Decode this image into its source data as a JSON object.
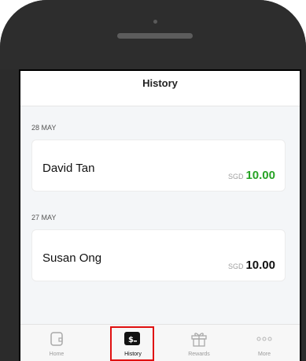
{
  "header": {
    "title": "History"
  },
  "history": [
    {
      "date": "28 MAY",
      "name": "David Tan",
      "currency": "SGD",
      "amount": "10.00",
      "amount_color": "#27a325"
    },
    {
      "date": "27 MAY",
      "name": "Susan Ong",
      "currency": "SGD",
      "amount": "10.00",
      "amount_color": "#111111"
    }
  ],
  "tabs": [
    {
      "label": "Home",
      "icon": "wallet-icon"
    },
    {
      "label": "History",
      "icon": "history-dollar-icon",
      "active": true
    },
    {
      "label": "Rewards",
      "icon": "gift-icon"
    },
    {
      "label": "More",
      "icon": "more-dots-icon"
    }
  ]
}
